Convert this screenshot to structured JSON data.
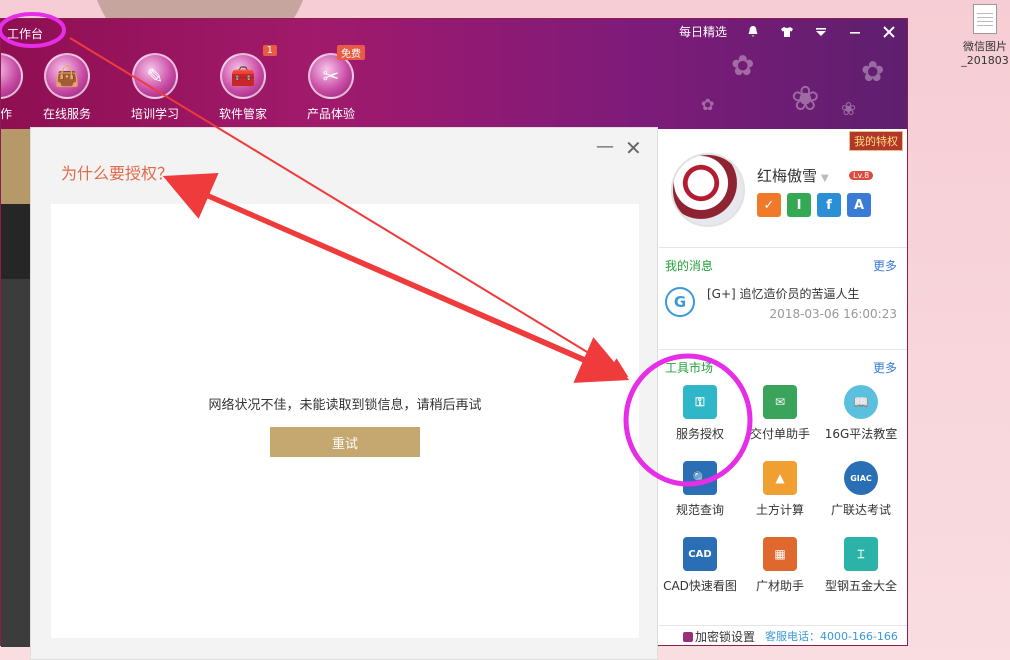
{
  "desktop": {
    "file_icon_label_1": "微信图片",
    "file_icon_label_2": "_201803"
  },
  "app": {
    "title": "工作台",
    "top_right": {
      "daily_pick": "每日精选"
    },
    "nav": [
      {
        "label": "作"
      },
      {
        "label": "在线服务"
      },
      {
        "label": "培训学习"
      },
      {
        "label": "软件管家",
        "tag": "1"
      },
      {
        "label": "产品体验",
        "tag": "免费"
      }
    ]
  },
  "dialog": {
    "title": "为什么要授权？",
    "message": "网络状况不佳，未能读取到锁信息，请稍后再试",
    "retry_label": "重试"
  },
  "side": {
    "privilege_label": "我的特权",
    "username": "红梅傲雪",
    "level": "Lv.8",
    "badges": [
      {
        "letter": "✓",
        "color": "#f07a2a"
      },
      {
        "letter": "I",
        "color": "#34a853"
      },
      {
        "letter": "f",
        "color": "#2b8fd6"
      },
      {
        "letter": "A",
        "color": "#3a7bd5"
      }
    ],
    "messages": {
      "heading": "我的消息",
      "more": "更多",
      "item_text": "[G+] 追忆造价员的苦逼人生",
      "item_time": "2018-03-06 16:00:23"
    },
    "tools": {
      "heading": "工具市场",
      "more": "更多",
      "items": [
        {
          "label": "服务授权",
          "color": "#2fb6c9"
        },
        {
          "label": "交付单助手",
          "color": "#3aa55a"
        },
        {
          "label": "16G平法教室",
          "color": "#5bc0de"
        },
        {
          "label": "规范查询",
          "color": "#2a6fb5"
        },
        {
          "label": "土方计算",
          "color": "#f0a030"
        },
        {
          "label": "广联达考试",
          "color": "#2a6fb5"
        },
        {
          "label": "CAD快速看图",
          "color": "#2a6fb5"
        },
        {
          "label": "广材助手",
          "color": "#e0672e"
        },
        {
          "label": "型钢五金大全",
          "color": "#2ab3a6"
        }
      ]
    },
    "footer": {
      "lock_settings": "加密锁设置",
      "hotline": "客服电话：4000-166-166"
    }
  },
  "colors": {
    "titlebar": "#9b1562",
    "dialog_title": "#e06a4a",
    "retry_button": "#c4a86f",
    "annotation": "#e62ee6",
    "arrow": "#ef3b3b"
  }
}
